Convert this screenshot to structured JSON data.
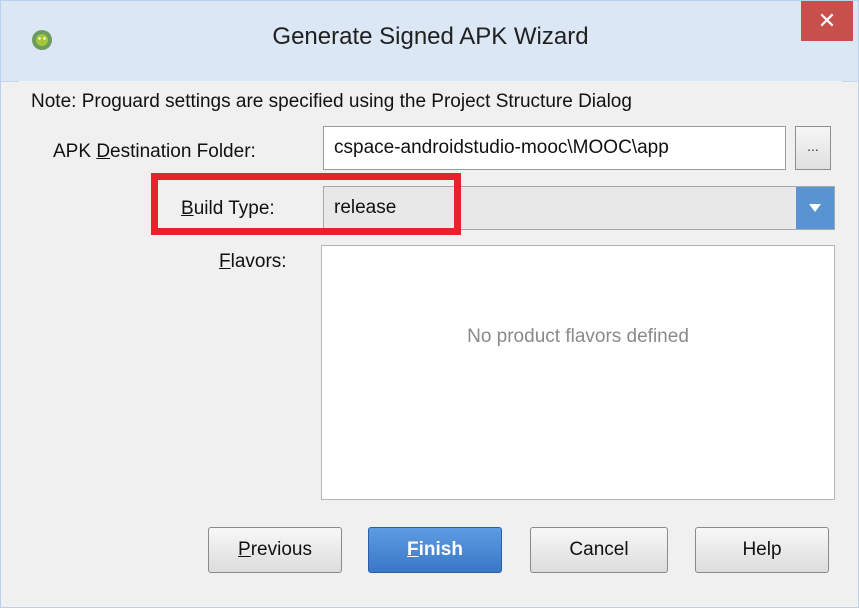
{
  "window": {
    "title": "Generate Signed APK Wizard",
    "close_glyph": "✕"
  },
  "note": "Note: Proguard settings are specified using the Project Structure Dialog",
  "destination": {
    "label_prefix": "APK ",
    "label_mnemonic": "D",
    "label_rest": "estination Folder:",
    "value": "cspace-androidstudio-mooc\\MOOC\\app",
    "browse_label": "..."
  },
  "build_type": {
    "label_mnemonic": "B",
    "label_rest": "uild Type:",
    "selected": "release"
  },
  "flavors": {
    "label_mnemonic": "F",
    "label_rest": "lavors:",
    "empty_text": "No product flavors defined"
  },
  "buttons": {
    "previous_mnemonic": "P",
    "previous_rest": "revious",
    "finish_mnemonic": "F",
    "finish_rest": "inish",
    "cancel": "Cancel",
    "help": "Help"
  },
  "colors": {
    "highlight": "#e8222a",
    "accent": "#3a78c8",
    "close": "#c7504d"
  },
  "icons": {
    "app": "android-studio-icon",
    "close": "close-icon",
    "dropdown": "chevron-down-icon"
  }
}
